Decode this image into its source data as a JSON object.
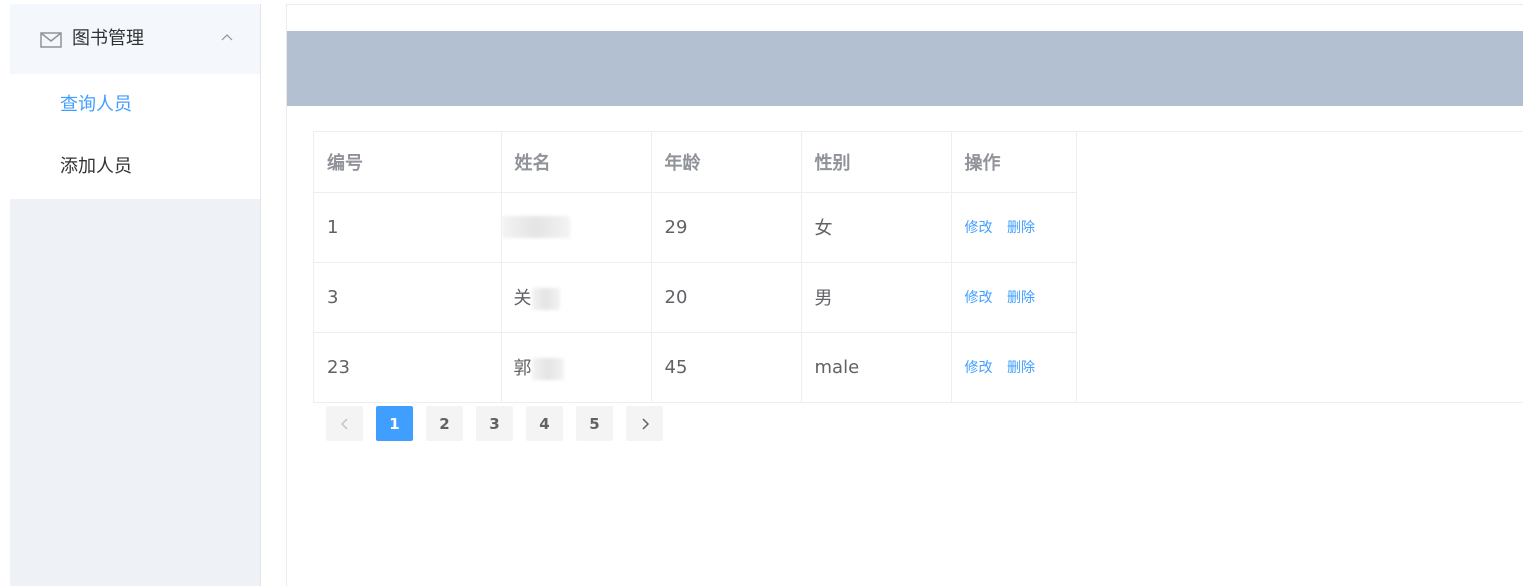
{
  "sidebar": {
    "submenu": {
      "icon": "mail-icon",
      "title": "图书管理",
      "arrow_icon": "chevron-up-icon"
    },
    "items": [
      {
        "label": "查询人员",
        "active": true
      },
      {
        "label": "添加人员",
        "active": false
      }
    ]
  },
  "colors": {
    "accent": "#409eff",
    "header_bar": "#b3c0d1",
    "sidebar_bg": "#eef1f6"
  },
  "table": {
    "columns": [
      "编号",
      "姓名",
      "年龄",
      "性别",
      "操作"
    ],
    "rows": [
      {
        "id": "1",
        "name": "",
        "age": "29",
        "gender": "女",
        "edit": "修改",
        "delete": "删除"
      },
      {
        "id": "3",
        "name": "关",
        "age": "20",
        "gender": "男",
        "edit": "修改",
        "delete": "删除"
      },
      {
        "id": "23",
        "name": "郭",
        "age": "45",
        "gender": "male",
        "edit": "修改",
        "delete": "删除"
      }
    ]
  },
  "pagination": {
    "prev_icon": "chevron-left-icon",
    "next_icon": "chevron-right-icon",
    "pages": [
      "1",
      "2",
      "3",
      "4",
      "5"
    ],
    "current": "1"
  }
}
